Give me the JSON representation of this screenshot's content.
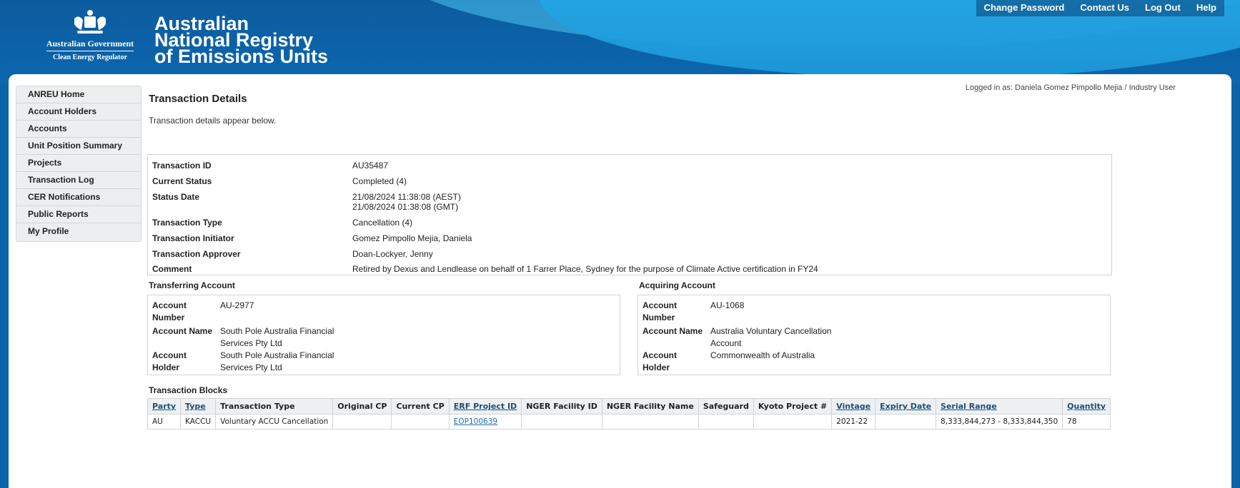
{
  "header": {
    "gov_name": "Australian Government",
    "gov_sub": "Clean Energy Regulator",
    "title_lines": [
      "Australian",
      "National Registry",
      "of Emissions Units"
    ],
    "links": [
      "Change Password",
      "Contact Us",
      "Log Out",
      "Help"
    ]
  },
  "sidebar": {
    "items": [
      "ANREU Home",
      "Account Holders",
      "Accounts",
      "Unit Position Summary",
      "Projects",
      "Transaction Log",
      "CER Notifications",
      "Public Reports",
      "My Profile"
    ]
  },
  "main": {
    "logged_in": "Logged in as:  Daniela Gomez Pimpollo Mejia / Industry User",
    "title": "Transaction Details",
    "intro": "Transaction details appear below.",
    "details": {
      "transaction_id_label": "Transaction ID",
      "transaction_id": "AU35487",
      "current_status_label": "Current Status",
      "current_status": "Completed (4)",
      "status_date_label": "Status Date",
      "status_date_aest": "21/08/2024 11:38:08 (AEST)",
      "status_date_gmt": "21/08/2024 01:38:08 (GMT)",
      "transaction_type_label": "Transaction Type",
      "transaction_type": "Cancellation (4)",
      "initiator_label": "Transaction Initiator",
      "initiator": "Gomez Pimpollo Mejia, Daniela",
      "approver_label": "Transaction Approver",
      "approver": "Doan-Lockyer, Jenny",
      "comment_label": "Comment",
      "comment": "Retired by Dexus and Lendlease on behalf of 1 Farrer Place, Sydney for the purpose of Climate Active certification in FY24"
    },
    "transferring": {
      "title": "Transferring Account",
      "number_label": "Account Number",
      "number": "AU-2977",
      "name_label": "Account Name",
      "name": "South Pole Australia Financial Services Pty Ltd",
      "holder_label": "Account Holder",
      "holder": "South Pole Australia Financial Services Pty Ltd"
    },
    "acquiring": {
      "title": "Acquiring Account",
      "number_label": "Account Number",
      "number": "AU-1068",
      "name_label": "Account Name",
      "name": "Australia Voluntary Cancellation Account",
      "holder_label": "Account Holder",
      "holder": "Commonwealth of Australia"
    },
    "blocks": {
      "title": "Transaction Blocks",
      "columns": [
        "Party",
        "Type",
        "Transaction Type",
        "Original CP",
        "Current CP",
        "ERF Project ID",
        "NGER Facility ID",
        "NGER Facility Name",
        "Safeguard",
        "Kyoto Project #",
        "Vintage",
        "Expiry Date",
        "Serial Range",
        "Quantity"
      ],
      "rows": [
        [
          "AU",
          "KACCU",
          "Voluntary ACCU Cancellation",
          "",
          "",
          "EOP100639",
          "",
          "",
          "",
          "",
          "2021-22",
          "",
          "8,333,844,273 - 8,333,844,350",
          "78"
        ]
      ]
    }
  }
}
